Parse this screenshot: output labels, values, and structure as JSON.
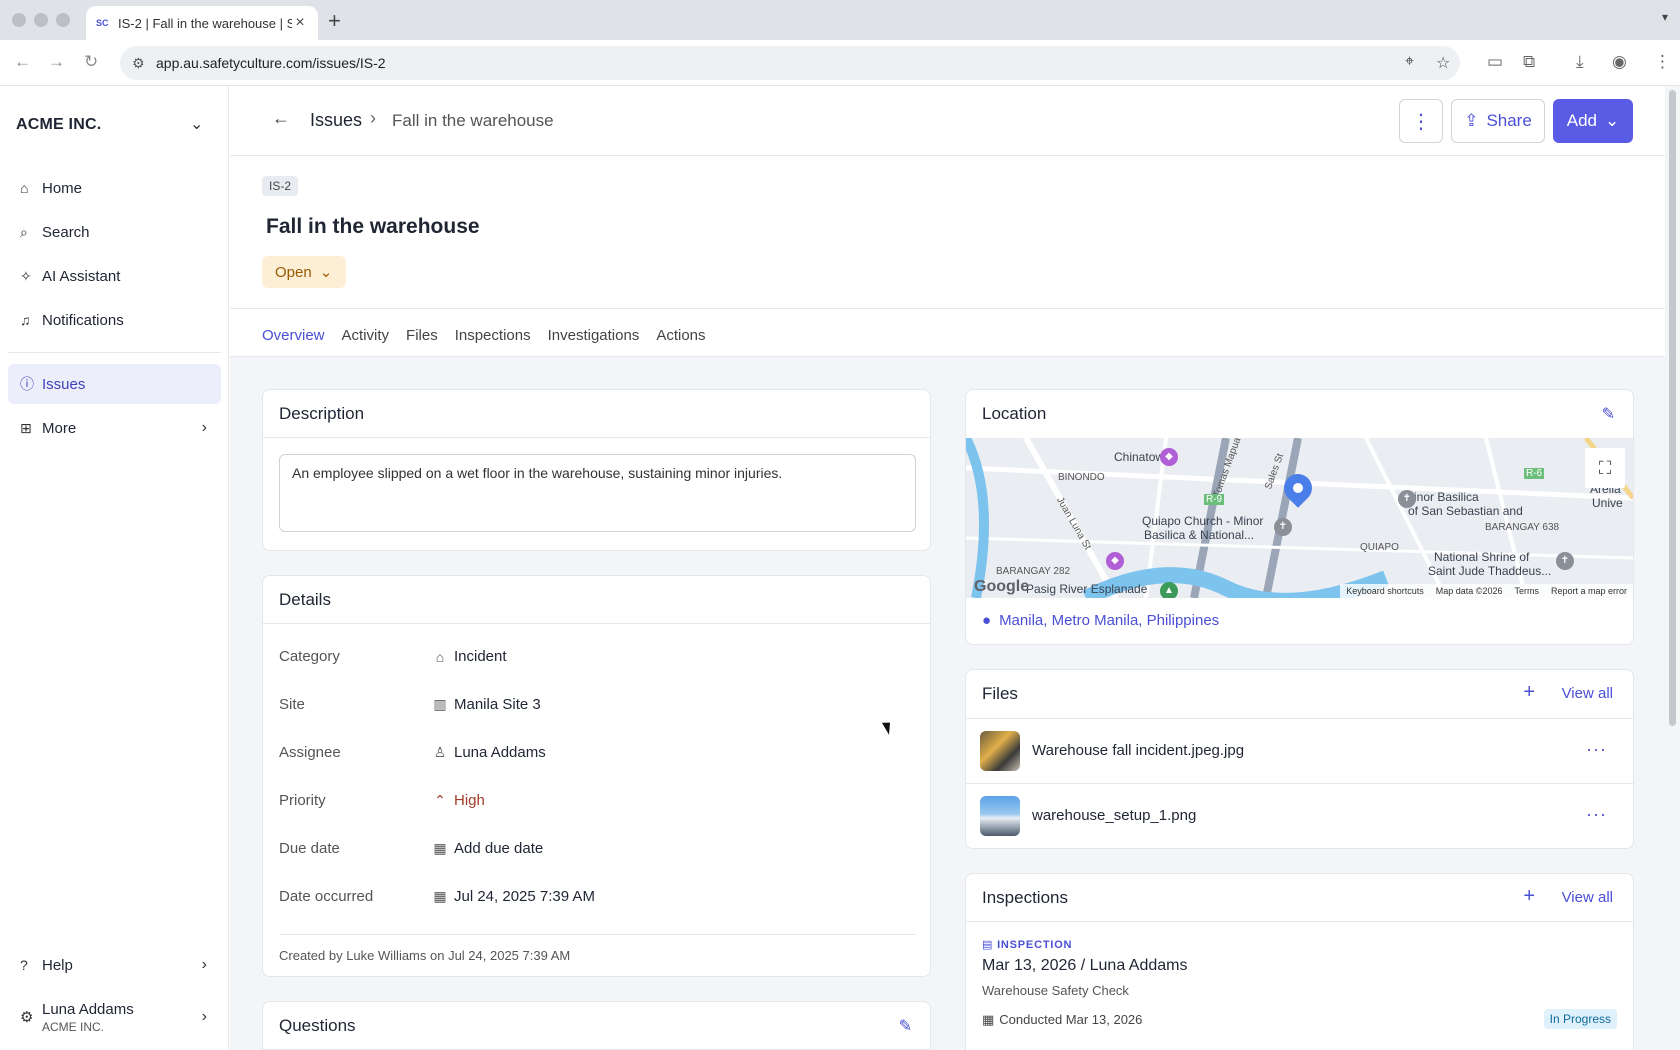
{
  "browser": {
    "tab_title": "IS-2 | Fall in the warehouse | S",
    "favicon": "SC",
    "url": "app.au.safetyculture.com/issues/IS-2"
  },
  "sidebar": {
    "org_name": "ACME INC.",
    "items": [
      {
        "label": "Home",
        "icon": "home-icon"
      },
      {
        "label": "Search",
        "icon": "search-icon"
      },
      {
        "label": "AI Assistant",
        "icon": "sparkle-icon"
      },
      {
        "label": "Notifications",
        "icon": "bell-icon"
      },
      {
        "label": "Issues",
        "icon": "issue-icon"
      },
      {
        "label": "More",
        "icon": "grid-icon"
      },
      {
        "label": "Help",
        "icon": "help-icon"
      }
    ],
    "user": {
      "name": "Luna Addams",
      "org": "ACME INC."
    }
  },
  "header": {
    "breadcrumb_root": "Issues",
    "breadcrumb_current": "Fall in the warehouse",
    "share_label": "Share",
    "add_label": "Add"
  },
  "issue": {
    "id": "IS-2",
    "title": "Fall in the warehouse",
    "status": "Open"
  },
  "tabs": [
    "Overview",
    "Activity",
    "Files",
    "Inspections",
    "Investigations",
    "Actions"
  ],
  "description": {
    "heading": "Description",
    "text": "An employee slipped on a wet floor in the warehouse, sustaining minor injuries."
  },
  "details": {
    "heading": "Details",
    "rows": [
      {
        "label": "Category",
        "value": "Incident"
      },
      {
        "label": "Site",
        "value": "Manila Site 3"
      },
      {
        "label": "Assignee",
        "value": "Luna Addams"
      },
      {
        "label": "Priority",
        "value": "High"
      },
      {
        "label": "Due date",
        "value": "Add due date"
      },
      {
        "label": "Date occurred",
        "value": "Jul 24, 2025 7:39 AM"
      }
    ],
    "created": "Created by Luke Williams on Jul 24, 2025 7:39 AM"
  },
  "questions": {
    "heading": "Questions"
  },
  "location": {
    "heading": "Location",
    "address": "Manila, Metro Manila, Philippines",
    "map_labels": [
      "Chinatown",
      "BINONDO",
      "Juan Luna St",
      "Tomas Mapua",
      "Sales St",
      "R-9",
      "R-6",
      "Quiapo Church - Minor",
      "Basilica & National...",
      "Minor Basilica",
      "of San Sebastian and",
      "BARANGAY 638",
      "QUIAPO",
      "National Shrine of",
      "Saint Jude Thaddeus...",
      "BARANGAY 282",
      "Pasig River Esplanade",
      "Areila",
      "Unive"
    ],
    "map_footer": [
      "Keyboard shortcuts",
      "Map data ©2026",
      "Terms",
      "Report a map error"
    ],
    "map_logo": "Google"
  },
  "files": {
    "heading": "Files",
    "view_all": "View all",
    "items": [
      {
        "name": "Warehouse fall incident.jpeg.jpg"
      },
      {
        "name": "warehouse_setup_1.png"
      }
    ]
  },
  "inspections": {
    "heading": "Inspections",
    "view_all": "View all",
    "tag": "INSPECTION",
    "title": "Mar 13, 2026 / Luna Addams",
    "template": "Warehouse Safety Check",
    "conducted": "Conducted Mar 13, 2026",
    "status": "In Progress"
  }
}
